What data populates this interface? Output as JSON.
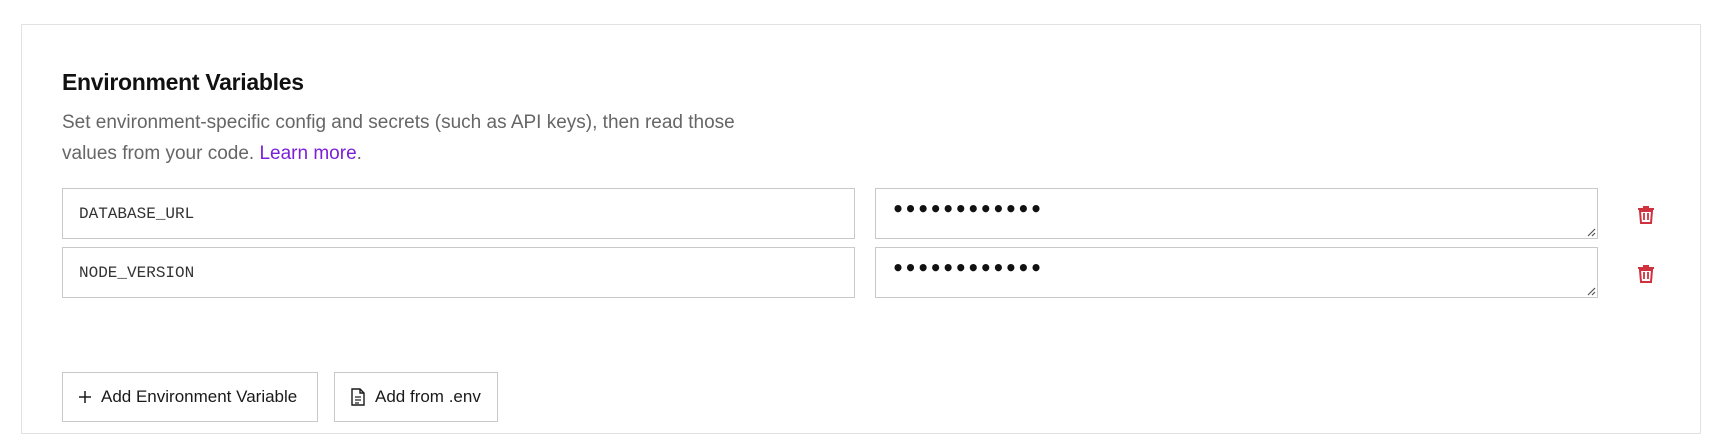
{
  "section": {
    "title": "Environment Variables",
    "description": "Set environment-specific config and secrets (such as API keys), then read those values from your code.",
    "learn_more_label": "Learn more",
    "trailing_period": "."
  },
  "variables": [
    {
      "key": "DATABASE_URL",
      "value_masked": "••••••••••••"
    },
    {
      "key": "NODE_VERSION",
      "value_masked": "••••••••••••"
    }
  ],
  "actions": {
    "add_variable_label": "Add Environment Variable",
    "add_from_env_label": "Add from .env"
  },
  "icons": {
    "delete": "trash-icon",
    "add": "plus-icon",
    "file": "file-icon"
  },
  "colors": {
    "accent_link": "#7c1fd8",
    "delete_icon": "#d0313f",
    "border": "#c9c9c9"
  }
}
